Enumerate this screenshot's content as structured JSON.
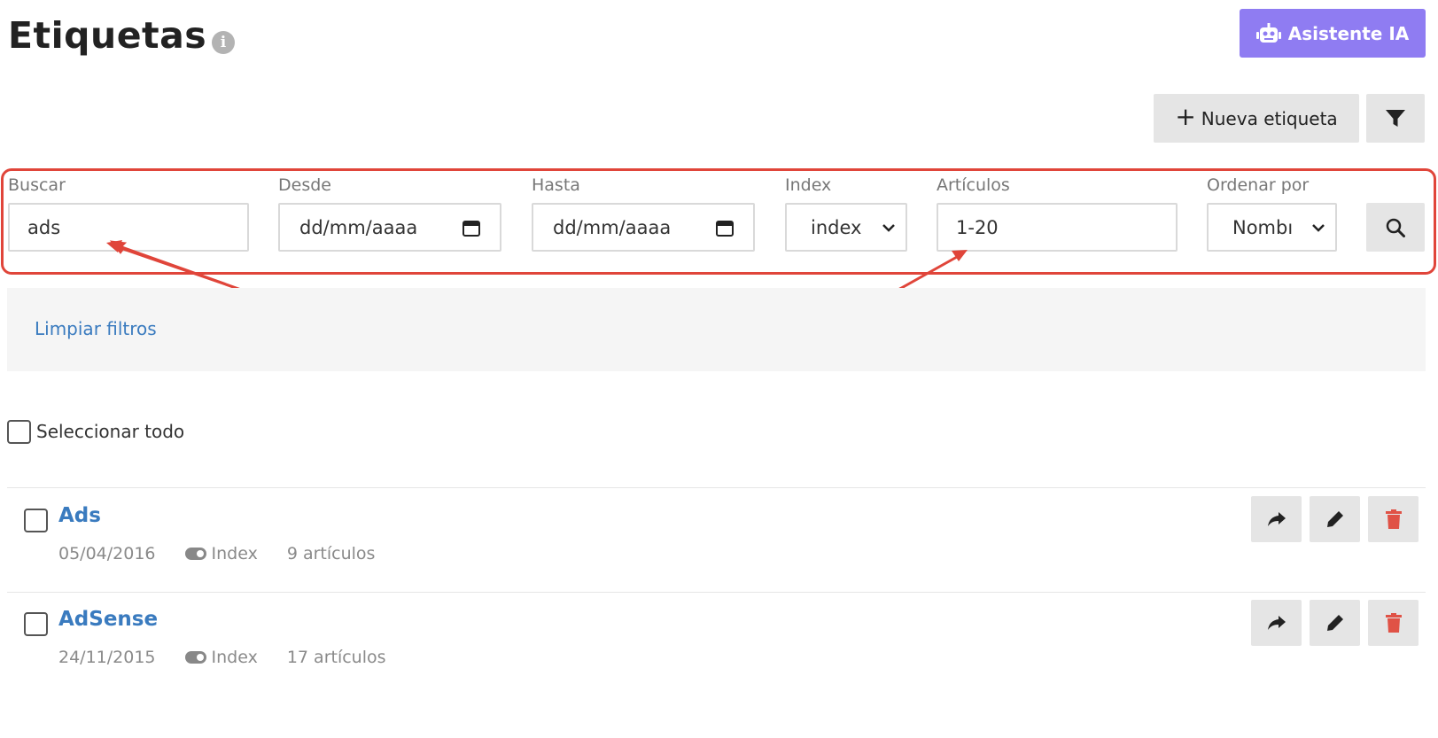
{
  "header": {
    "title": "Etiquetas",
    "info_icon": "info-circle-icon",
    "ai_button_label": "Asistente IA",
    "ai_icon": "robot-icon",
    "ai_color": "#8f7cf2"
  },
  "toolbar": {
    "new_label": "Nueva etiqueta",
    "new_icon": "plus-icon",
    "filter_icon": "funnel-icon"
  },
  "filters": {
    "search": {
      "label": "Buscar",
      "value": "ads"
    },
    "from": {
      "label": "Desde",
      "value": "dd/mm/aaaa"
    },
    "to": {
      "label": "Hasta",
      "value": "dd/mm/aaaa"
    },
    "index": {
      "label": "Index",
      "value": "index"
    },
    "articles": {
      "label": "Artículos",
      "value": "1-20"
    },
    "order": {
      "label": "Ordenar por",
      "value": "Nombı"
    },
    "search_icon": "magnifier-icon",
    "highlight_color": "#e0453a"
  },
  "clear": {
    "label": "Limpiar filtros"
  },
  "select_all": {
    "label": "Seleccionar todo"
  },
  "items": [
    {
      "title": "Ads",
      "date": "05/04/2016",
      "index": "Index",
      "articles": "9 artículos"
    },
    {
      "title": "AdSense",
      "date": "24/11/2015",
      "index": "Index",
      "articles": "17 artículos"
    }
  ],
  "colors": {
    "link": "#3a7bbf",
    "delete": "#e05246"
  }
}
